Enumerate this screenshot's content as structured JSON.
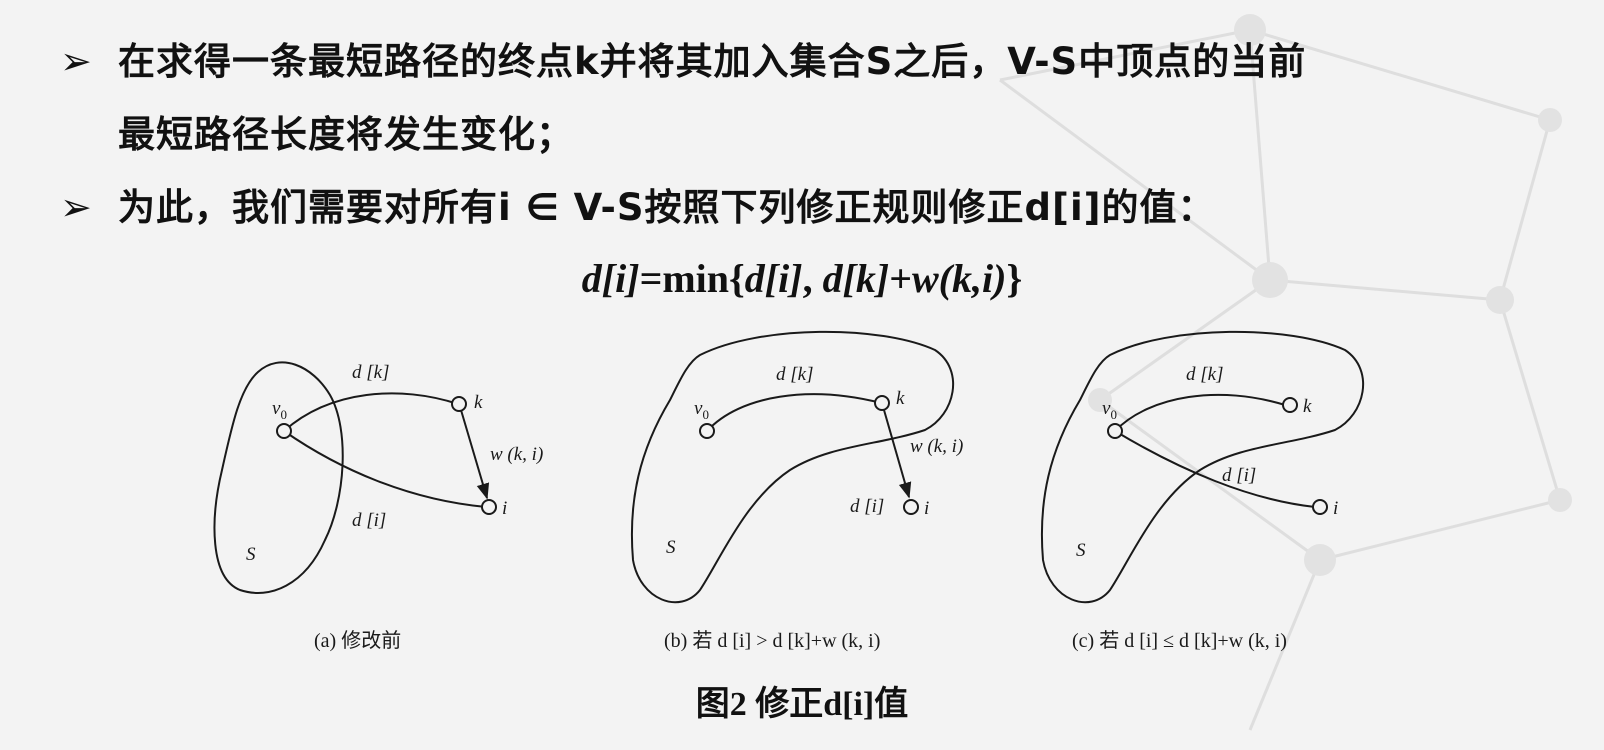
{
  "bullets": [
    {
      "marker": "➢",
      "line1": "在求得一条最短路径的终点k并将其加入集合S之后，V-S中顶点的当前",
      "line2": "最短路径长度将发生变化；"
    },
    {
      "marker": "➢",
      "line1": "为此，我们需要对所有i ∈ V-S按照下列修正规则修正d[i]的值："
    }
  ],
  "formula": {
    "lhs": "d[i]",
    "op": "=min{",
    "arg1": "d[i]",
    "sep": ", ",
    "arg2": "d[k]",
    "plus": "+",
    "arg3": "w(k,i)",
    "close": "}"
  },
  "diagrams": [
    {
      "id": "a",
      "caption": "(a)  修改前",
      "set_label": "S",
      "v0_label": "v",
      "v0_sub": "0",
      "k_label": "k",
      "i_label": "i",
      "edge_dk": "d [k]",
      "edge_di": "d [i]",
      "edge_w": "w (k, i)"
    },
    {
      "id": "b",
      "caption": "(b)  若 d [i] > d [k]+w (k, i)",
      "set_label": "S",
      "v0_label": "v",
      "v0_sub": "0",
      "k_label": "k",
      "i_label": "i",
      "edge_dk": "d [k]",
      "node_di": "d [i]",
      "edge_w": "w (k, i)"
    },
    {
      "id": "c",
      "caption": "(c)  若 d [i] ≤ d [k]+w (k, i)",
      "set_label": "S",
      "v0_label": "v",
      "v0_sub": "0",
      "k_label": "k",
      "i_label": "i",
      "edge_dk": "d [k]",
      "edge_di": "d [i]"
    }
  ],
  "figure_title": "图2 修正d[i]值",
  "colors": {
    "background": "#f3f3f3",
    "text": "#111111",
    "deco": "#d9d9d9"
  }
}
